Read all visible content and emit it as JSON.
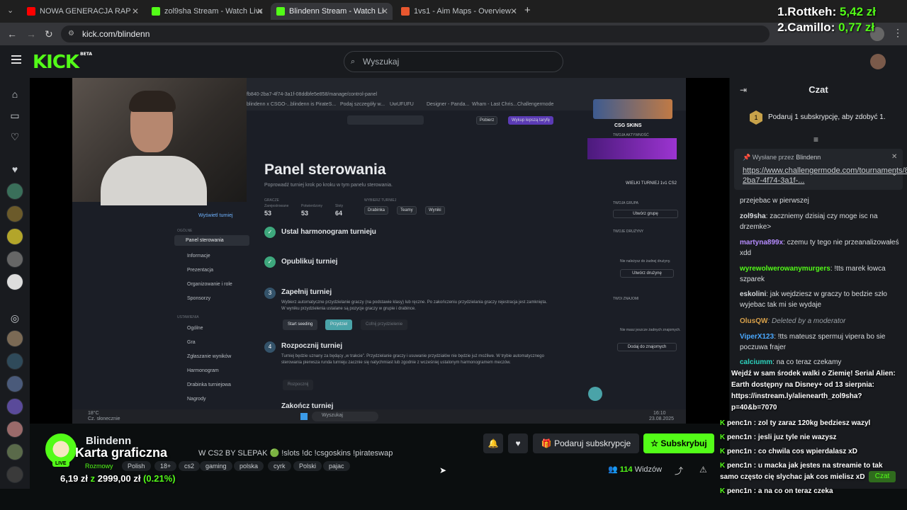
{
  "browser": {
    "tabs": [
      {
        "title": "NOWA GENERACJA RAP",
        "favicon_color": "#ff0000"
      },
      {
        "title": "zol9sha Stream - Watch Live on",
        "favicon_color": "#53fc18"
      },
      {
        "title": "Blindenn Stream - Watch Li",
        "favicon_color": "#53fc18"
      },
      {
        "title": "1vs1 - Aim Maps - Overview -",
        "favicon_color": "#e8572f"
      }
    ],
    "url": "kick.com/blindenn"
  },
  "ranking": [
    {
      "name": "1.Rottkeh: ",
      "amount": "5,42 zł"
    },
    {
      "name": "2.Camillo: ",
      "amount": "0,77 zł"
    }
  ],
  "kick": {
    "logo": "KICK",
    "logo_badge": "BETA",
    "search_placeholder": "Wyszukaj"
  },
  "screen": {
    "url_fragment": "fb840-2ba7-4f74-3a1f-08ddbfe5e858/manage/control-panel",
    "bookmarks": [
      "blindenn x CSGO-...",
      "blindenn is PirateS...",
      "Podaj szczegóły w...",
      "UwUFUFU",
      "Designer - Panda...",
      "Wham - Last Chris...",
      "Challengermode"
    ],
    "panel_title": "Panel sterowania",
    "panel_sub": "Poprowadź turniej krok po kroku w tym panelu sterowania.",
    "stats_header": "GRACZE",
    "stats": [
      {
        "label": "Zarejestrowane",
        "value": "53"
      },
      {
        "label": "Potwierdzony",
        "value": "53"
      },
      {
        "label": "Sloty",
        "value": "64"
      }
    ],
    "tournament_header": "WYBIERZ TURNIEJ",
    "chips": [
      "Drabinka",
      "Teamy",
      "Wyniki"
    ],
    "download_btn": "Pobierz",
    "upgrade_btn": "Wykup lepszą taryfę",
    "back_link": "Wyświetl turniej",
    "sidebar_section1": "OGÓLNE",
    "sidebar_items1": [
      "Panel sterowania",
      "Informacje",
      "Prezentacja",
      "Organizowanie i role",
      "Sponsorzy"
    ],
    "sidebar_section2": "USTAWIENIA",
    "sidebar_items2": [
      "Ogólne",
      "Gra",
      "Zgłaszanie wyników",
      "Harmonogram",
      "Drabinka turniejowa",
      "Nagrody"
    ],
    "steps": [
      {
        "num": "✓",
        "title": "Ustal harmonogram turnieju"
      },
      {
        "num": "✓",
        "title": "Opublikuj turniej"
      },
      {
        "num": "3",
        "title": "Zapełnij turniej",
        "desc": "Wybierz automatyczne przydzielanie graczy (na podstawie klasy) lub ręczne. Po zakończeniu przydzielania graczy rejestracja jest zamknięta. W wyniku przydzielenia ustalane są pozycje graczy w grupie i drabince."
      },
      {
        "num": "4",
        "title": "Rozpocznij turniej",
        "desc": "Turniej będzie uznany za będący „w trakcie”. Przydzielanie graczy i usuwanie przydziałów nie będzie już możliwe. W trybie automatycznego sterowania pierwsza runda turnieju zacznie się natychmiast lub zgodnie z wcześniej ustalonym harmonogramem meczów."
      },
      {
        "num": "5",
        "title": "Zakończ turniej"
      }
    ],
    "step3_buttons": [
      "Start seeding",
      "Przydziel",
      "Cofnij przydzielenie"
    ],
    "step4_button": "Rozpocznij",
    "csgo_logo": "CSG SKINS",
    "right_panel": {
      "activity_header": "TWOJA AKTYWNOŚĆ",
      "tournament_name": "WIELKI TURNIEJ 1v1 CS2",
      "group_header": "TWOJA GRUPA",
      "group_btn": "Utwórz grupę",
      "team_header": "TWOJE DRUŻYNY",
      "team_empty": "Nie należysz do żadnej drużyny.",
      "team_btn": "Utwórz drużynę",
      "friends_header": "TWOI ZNAJOMI",
      "friends_empty": "Nie masz jeszcze żadnych znajomych.",
      "friends_btn": "Dodaj do znajomych"
    },
    "taskbar": {
      "weather": "18°C",
      "weather_desc": "Cz. słonecznie",
      "search": "Wyszukaj",
      "time": "16:10",
      "date": "23.08.2025"
    }
  },
  "stream": {
    "channel": "Blindenn",
    "live": "LIVE",
    "title": "W CS2 BY SLEPAK 🟢 !slots !dc !csgoskins !pirateswap",
    "tags": [
      "Rozmowy",
      "Polish",
      "18+",
      "cs2",
      "gaming",
      "polska",
      "cyrk",
      "Polski",
      "pajac"
    ],
    "overlay_title": "Karta graficzna",
    "overlay_price_current": "6,19 zł ",
    "overlay_price_sep": "z",
    "overlay_price_goal": " 2999,00 zł ",
    "overlay_price_pct": "(0.21%)",
    "gift_btn": "Podaruj subskrypcje",
    "subscribe_btn": "Subskrybuj",
    "viewers_count": "114",
    "viewers_label": " Widzów"
  },
  "chat": {
    "title": "Czat",
    "gift_tip": "Podaruj 1 subskrypcję, aby zdobyć 1.",
    "gift_badge": "1",
    "pinned_by": "Wysłane przez",
    "pinned_user": "Blindenn",
    "pinned_link": "https://www.challengermode.com/tournaments/8f1fb840-2ba7-4f74-3a1f-...",
    "messages": [
      {
        "user": "",
        "text": "przejebac w pierwszej",
        "color": "#d8dbde"
      },
      {
        "user": "zol9sha",
        "text": ": zaczniemy dzisiaj czy moge isc na drzemke>",
        "color": "#d8dbde"
      },
      {
        "user": "martyna899x",
        "text": ": czemu ty tego nie przeanalizowałeś xdd",
        "color": "#b68cff"
      },
      {
        "user": "wyrewolwerowanymurgers",
        "text": ": !tts marek łowca szparek",
        "color": "#53fc18"
      },
      {
        "user": "eskolini",
        "text": ": jak wejdziesz w graczy to bedzie szło wyjebac tak mi sie wydaje",
        "color": "#e6e8ea"
      },
      {
        "user": "OlusQW",
        "text": ": Deleted by a moderator",
        "color": "#d9a14a"
      },
      {
        "user": "ViperX123",
        "text": ": !tts mateusz spermuj vipera bo sie poczuwa frajer",
        "color": "#4aa8ff"
      },
      {
        "user": "calciumm",
        "text": ": na co teraz czekamy",
        "color": "#2dd4bf"
      }
    ]
  },
  "overlay_chat": {
    "promo": "Wejdź w sam środek walki o Ziemię! Serial Alien: Earth dostępny na Disney+ od 13 sierpnia: https://instream.ly/alienearth_zol9sha?p=40&b=7070",
    "messages": [
      {
        "user": "penc1n",
        "text": " : zol ty zaraz 120kg bedziesz wazyl"
      },
      {
        "user": "penc1n",
        "text": " : jesli juz tyle nie wazysz"
      },
      {
        "user": "penc1n",
        "text": " : co chwila cos wpierdalasz xD"
      },
      {
        "user": "penc1n",
        "text": " : u macka jak jestes na streamie to tak samo często cię slychac jak cos mielisz xD"
      },
      {
        "user": "penc1n",
        "text": " : a na co on teraz czeka"
      }
    ],
    "chat_btn": "Czat"
  },
  "colors": {
    "brand": "#53fc18",
    "bg": "#0b0e0f",
    "panel": "#191b1f"
  }
}
